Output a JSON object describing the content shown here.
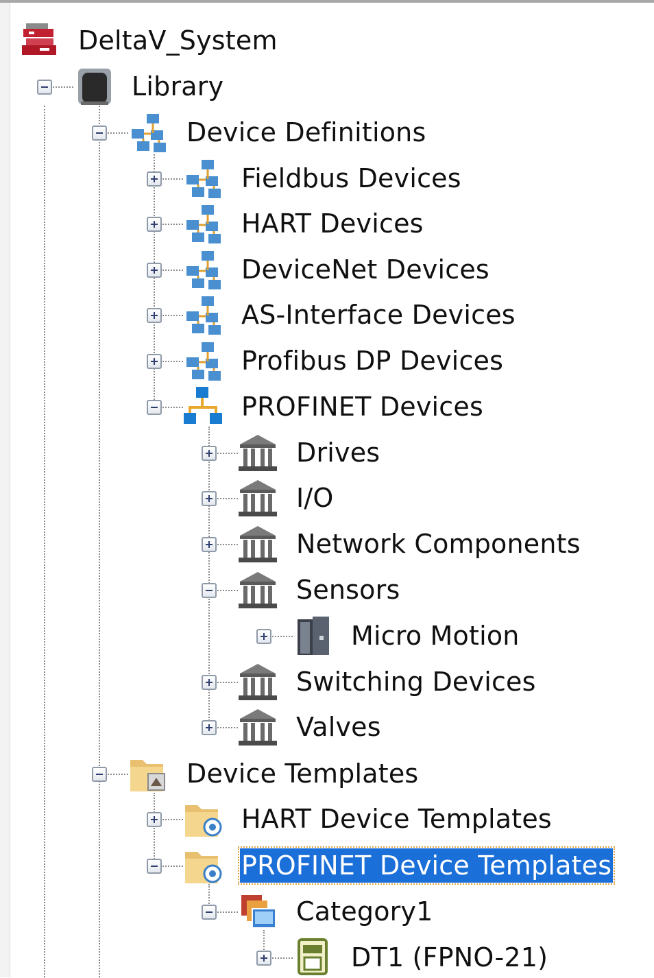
{
  "tree": {
    "root": {
      "label": "DeltaV_System",
      "icon": "deltav-system-icon"
    },
    "library": {
      "label": "Library",
      "icon": "library-icon"
    },
    "device_definitions": {
      "label": "Device Definitions",
      "children": [
        {
          "label": "Fieldbus Devices",
          "state": "collapsed"
        },
        {
          "label": "HART Devices",
          "state": "collapsed"
        },
        {
          "label": "DeviceNet Devices",
          "state": "collapsed"
        },
        {
          "label": "AS-Interface Devices",
          "state": "collapsed"
        },
        {
          "label": "Profibus DP Devices",
          "state": "collapsed"
        },
        {
          "label": "PROFINET Devices",
          "state": "expanded"
        }
      ]
    },
    "profinet_devices": {
      "children": [
        {
          "label": "Drives",
          "state": "collapsed"
        },
        {
          "label": "I/O",
          "state": "collapsed"
        },
        {
          "label": "Network Components",
          "state": "collapsed"
        },
        {
          "label": "Sensors",
          "state": "expanded"
        },
        {
          "label": "Switching Devices",
          "state": "collapsed"
        },
        {
          "label": "Valves",
          "state": "collapsed"
        }
      ],
      "sensors_children": [
        {
          "label": "Micro Motion",
          "state": "collapsed"
        }
      ]
    },
    "device_templates": {
      "label": "Device Templates",
      "children": [
        {
          "label": "HART Device Templates",
          "state": "collapsed"
        },
        {
          "label": "PROFINET Device Templates",
          "state": "expanded",
          "selected": true
        }
      ],
      "category": {
        "label": "Category1",
        "state": "expanded"
      },
      "template": {
        "label": "DT1 (FPNO-21)",
        "state": "collapsed"
      }
    }
  },
  "colors": {
    "selection_bg": "#1a6fd8",
    "selection_text": "#ffffff",
    "text": "#101010",
    "connector": "#8a8a8a"
  }
}
